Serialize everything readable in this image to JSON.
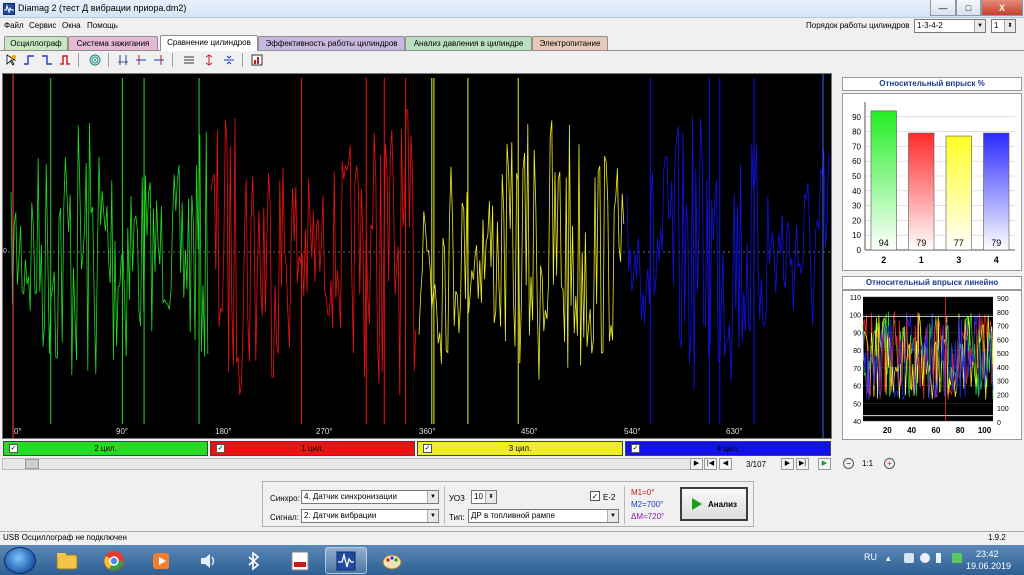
{
  "window": {
    "title": "Diamag 2 (тест Д вибрации приора.dm2)",
    "min": "—",
    "max": "□",
    "close": "X"
  },
  "menu": [
    "Файл",
    "Сервис",
    "Окна",
    "Помощь"
  ],
  "cylinder_order": {
    "label": "Порядок работы цилиндров",
    "value": "1-3-4-2",
    "spin_value": "1"
  },
  "tabs": [
    {
      "label": "Осциллограф",
      "color": "#c8e6c0"
    },
    {
      "label": "Система зажигания",
      "color": "#e6b8d4"
    },
    {
      "label": "Сравнение цилиндров",
      "color": "#ffffff",
      "active": true
    },
    {
      "label": "Эффективность работы цилиндров",
      "color": "#c8b8e0"
    },
    {
      "label": "Анализ давления в цилиндре",
      "color": "#b8e0c0"
    },
    {
      "label": "Электропитание",
      "color": "#e8c8b8"
    }
  ],
  "scope": {
    "x_ticks": [
      "0°",
      "90°",
      "180°",
      "270°",
      "360°",
      "450°",
      "540°",
      "630°"
    ],
    "zero_label": "0"
  },
  "cylinders": [
    {
      "label": "2 цил.",
      "color": "#22dd22",
      "checked": "✓"
    },
    {
      "label": "1 цил.",
      "color": "#ee1111",
      "checked": "✓"
    },
    {
      "label": "3 цил.",
      "color": "#eeee22",
      "checked": "✓"
    },
    {
      "label": "4 цил.",
      "color": "#1111ee",
      "checked": "✓"
    }
  ],
  "navigation": {
    "page": "3/107"
  },
  "relative_injection_bar": {
    "title": "Относительный впрыск %",
    "y_ticks": [
      "90",
      "80",
      "70",
      "60",
      "50",
      "40",
      "30",
      "20",
      "10",
      "0"
    ]
  },
  "chart_data": [
    {
      "type": "bar",
      "title": "Относительный впрыск %",
      "categories": [
        "2",
        "1",
        "3",
        "4"
      ],
      "values": [
        94,
        79,
        77,
        79
      ],
      "colors": [
        "#22ee22",
        "#ff2a2a",
        "#ffff22",
        "#2a2aff"
      ],
      "ylim": [
        0,
        100
      ],
      "grid": true
    },
    {
      "type": "line",
      "title": "Относительный впрыск линейно",
      "left_axis_ticks": [
        "110",
        "100",
        "90",
        "80",
        "70",
        "60",
        "50",
        "40"
      ],
      "right_axis_ticks": [
        "900",
        "800",
        "700",
        "600",
        "500",
        "400",
        "300",
        "200",
        "100",
        "0"
      ],
      "x_ticks": [
        "20",
        "40",
        "60",
        "80",
        "100"
      ],
      "xlim": [
        0,
        107
      ],
      "ylim": [
        40,
        110
      ]
    }
  ],
  "relative_injection_line": {
    "title": "Относительный впрыск линейно",
    "zoom": "1:1"
  },
  "controls": {
    "sync_label": "Синхро:",
    "sync_value": "4. Датчик синхронизации",
    "signal_label": "Сигнал:",
    "signal_value": "2. Датчик вибрации",
    "uoz_label": "УОЗ",
    "uoz_value": "10",
    "type_label": "Тип:",
    "type_value": "ДР в топливной рампе",
    "e2_label": "Е-2",
    "e2_checked": "✓",
    "m1": "M1=0°",
    "m2": "M2=700°",
    "dm": "ΔM=720°",
    "analyze": "Анализ"
  },
  "status": {
    "text": "USB Осциллограф не подключен",
    "version": "1.9.2"
  },
  "taskbar": {
    "lang": "RU",
    "time": "23:42",
    "date": "19.06.2019"
  }
}
